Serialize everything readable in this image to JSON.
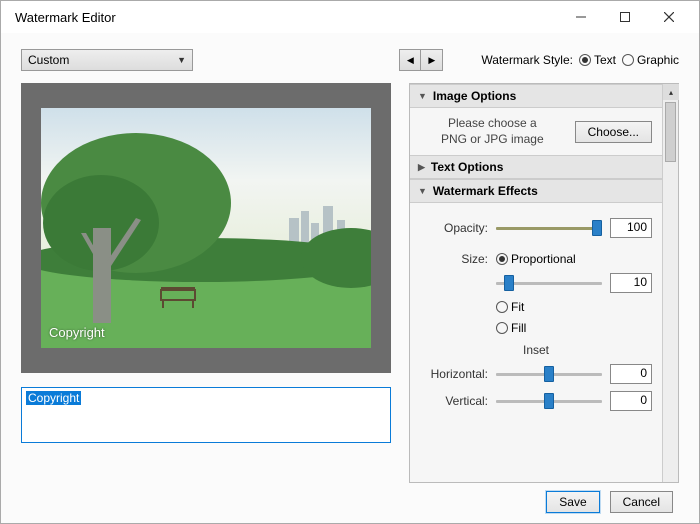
{
  "window": {
    "title": "Watermark Editor"
  },
  "preset": {
    "selected": "Custom"
  },
  "style": {
    "label": "Watermark Style:",
    "text": "Text",
    "graphic": "Graphic",
    "selected": "text"
  },
  "sections": {
    "image": {
      "title": "Image Options",
      "msg": "Please choose a\nPNG or JPG image",
      "choose": "Choose..."
    },
    "text": {
      "title": "Text Options"
    },
    "effects": {
      "title": "Watermark Effects",
      "opacity_label": "Opacity:",
      "opacity": 100,
      "size_label": "Size:",
      "proportional": "Proportional",
      "fit": "Fit",
      "fill": "Fill",
      "size_value": 10,
      "inset_label": "Inset",
      "horiz_label": "Horizontal:",
      "horiz": 0,
      "vert_label": "Vertical:",
      "vert": 0
    }
  },
  "watermark_text": "Copyright",
  "text_input": "Copyright",
  "buttons": {
    "save": "Save",
    "cancel": "Cancel"
  }
}
